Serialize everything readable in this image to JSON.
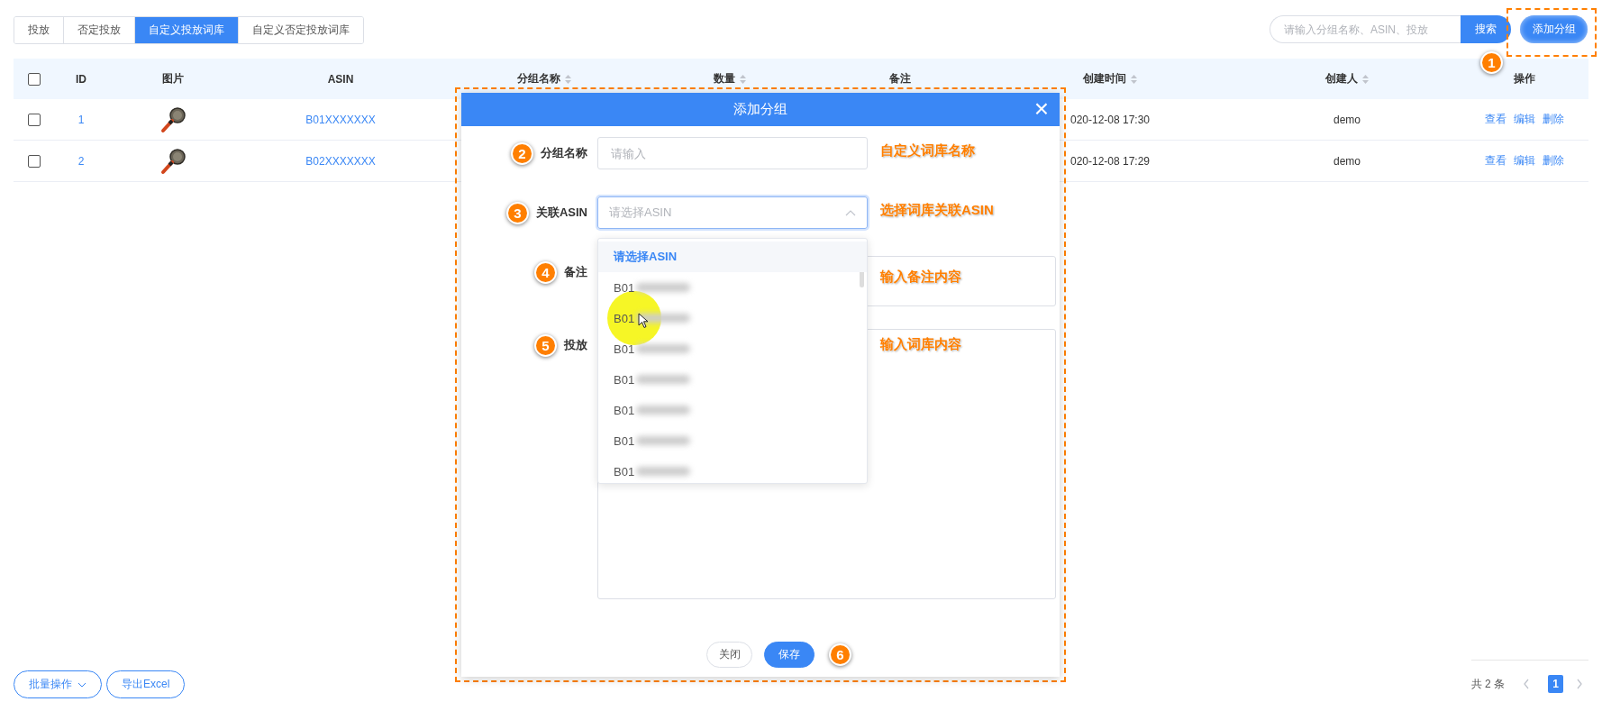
{
  "tabs": [
    {
      "label": "投放",
      "selected": false
    },
    {
      "label": "否定投放",
      "selected": false
    },
    {
      "label": "自定义投放词库",
      "selected": true
    },
    {
      "label": "自定义否定投放词库",
      "selected": false
    }
  ],
  "search": {
    "placeholder": "请输入分组名称、ASIN、投放",
    "button": "搜索"
  },
  "add_button": {
    "label": "添加分组",
    "callout": "1"
  },
  "table": {
    "header_checked": false,
    "columns": [
      {
        "label": "ID",
        "sortable": false
      },
      {
        "label": "图片",
        "sortable": false
      },
      {
        "label": "ASIN",
        "sortable": false
      },
      {
        "label": "分组名称",
        "sortable": true
      },
      {
        "label": "数量",
        "sortable": true
      },
      {
        "label": "备注",
        "sortable": false
      },
      {
        "label": "创建时间",
        "sortable": true
      },
      {
        "label": "创建人",
        "sortable": true
      },
      {
        "label": "操作",
        "sortable": false
      }
    ],
    "rows": [
      {
        "checked": false,
        "id": "1",
        "asin": "B01XXXXXXX",
        "created_at": "020-12-08 17:30",
        "creator": "demo",
        "actions": [
          "查看",
          "编辑",
          "删除"
        ]
      },
      {
        "checked": false,
        "id": "2",
        "asin": "B02XXXXXXX",
        "created_at": "020-12-08 17:29",
        "creator": "demo",
        "actions": [
          "查看",
          "编辑",
          "删除"
        ]
      }
    ]
  },
  "footer": {
    "batch_button": "批量操作",
    "export_button": "导出Excel"
  },
  "pagination": {
    "total": "共 2 条",
    "pages": [
      {
        "label": "1",
        "selected": true
      }
    ]
  },
  "dialog": {
    "title": "添加分组",
    "close": "×",
    "fields": [
      {
        "kind": "input",
        "label": "分组名称",
        "placeholder": "请输入",
        "callout": "2",
        "note": "自定义词库名称"
      },
      {
        "kind": "select",
        "label": "关联ASIN",
        "placeholder": "请选择ASIN",
        "callout": "3",
        "note": "选择词库关联ASIN",
        "expanded": true,
        "options": [
          {
            "label": "请选择ASIN",
            "selected": true,
            "hovered": false
          },
          {
            "label": "B01",
            "selected": false,
            "hovered": false
          },
          {
            "label": "B01",
            "selected": false,
            "hovered": true
          },
          {
            "label": "B01",
            "selected": false,
            "hovered": false
          },
          {
            "label": "B01",
            "selected": false,
            "hovered": false
          },
          {
            "label": "B01",
            "selected": false,
            "hovered": false
          },
          {
            "label": "B01",
            "selected": false,
            "hovered": false
          },
          {
            "label": "B01",
            "selected": false,
            "hovered": false
          }
        ]
      },
      {
        "kind": "memo",
        "label": "备注",
        "callout": "4",
        "note": "输入备注内容"
      },
      {
        "kind": "textarea",
        "label": "投放",
        "callout": "5",
        "note": "输入词库内容"
      }
    ],
    "buttons": [
      {
        "label": "关闭",
        "kind": "default"
      },
      {
        "label": "保存",
        "kind": "primary",
        "callout": "6"
      }
    ]
  }
}
